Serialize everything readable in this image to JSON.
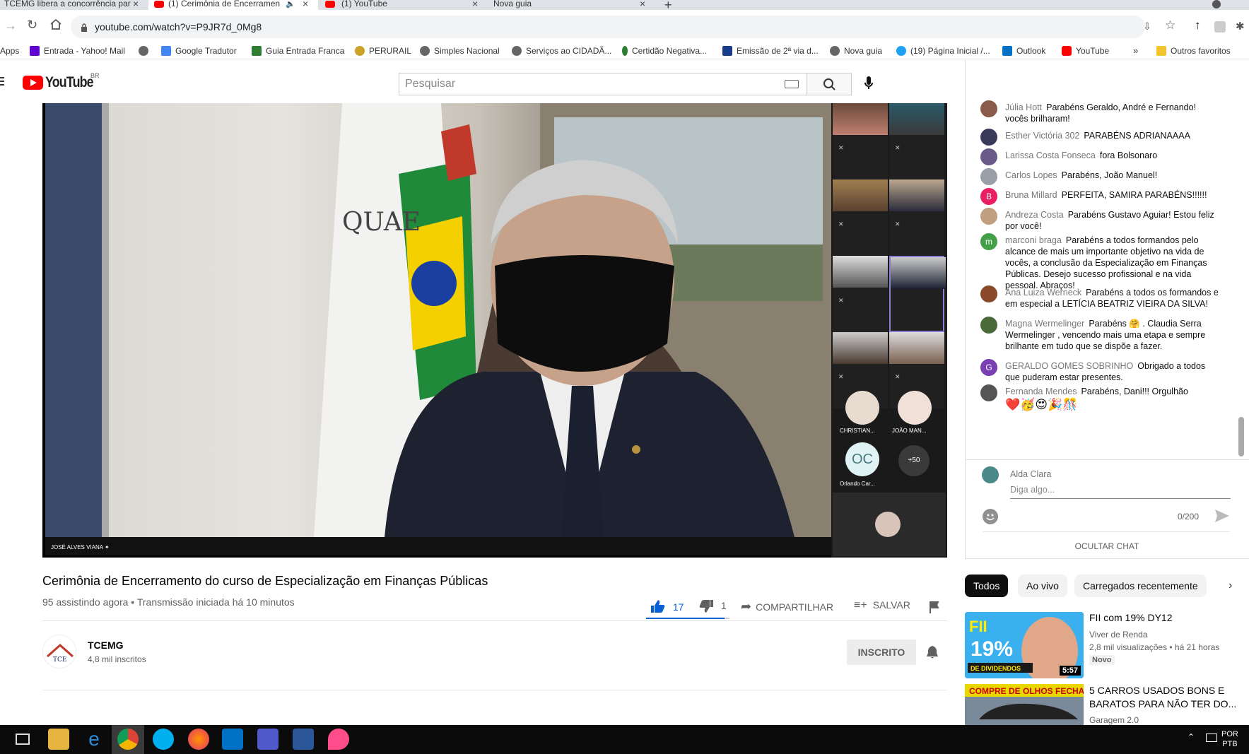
{
  "tabs": [
    {
      "title": "TCEMG libera a concorrência par",
      "active": false
    },
    {
      "title": "(1) Cerimônia de Encerramen",
      "active": true
    },
    {
      "title": "(1) YouTube",
      "active": false
    },
    {
      "title": "Nova guia",
      "active": false
    }
  ],
  "url": "youtube.com/watch?v=P9JR7d_0Mg8",
  "bookmarks": [
    "Apps",
    "Entrada - Yahoo! Mail",
    "Google Tradutor",
    "Guia Entrada Franca",
    "PERURAIL",
    "Simples Nacional",
    "Serviços ao CIDADÃ...",
    "Certidão Negativa...",
    "Emissão de 2ª via d...",
    "Nova guia",
    "(19) Página Inicial /...",
    "Outlook",
    "YouTube",
    "Outros favoritos"
  ],
  "yt": {
    "logo": "YouTube",
    "region": "BR",
    "search_placeholder": "Pesquisar"
  },
  "video": {
    "speaker_label": "JOSÉ ALVES VIANA",
    "participants": [
      "CHRISTIAN...",
      "JOÃO MAN...",
      "Orlando Car..."
    ],
    "avatar_initials": "OC",
    "more_count": "+50",
    "title": "Cerimônia de Encerramento do curso de Especialização em Finanças Públicas",
    "views": "95 assistindo agora • Transmissão iniciada há 10 minutos",
    "likes": "17",
    "dislikes": "1",
    "share": "COMPARTILHAR",
    "save": "SALVAR",
    "like_ratio": 0.94
  },
  "channel": {
    "name": "TCEMG",
    "subs": "4,8 mil inscritos",
    "subscribe": "INSCRITO"
  },
  "chat": {
    "messages": [
      {
        "author": "Júlia Hott",
        "text": "Parabéns Geraldo, André e Fernando! vocês brilharam!",
        "avatar_color": "#8a5a4a"
      },
      {
        "author": "Esther Victória 302",
        "text": "PARABÉNS ADRIANAAAA",
        "avatar_color": "#3a3a5a"
      },
      {
        "author": "Larissa Costa Fonseca",
        "text": "fora Bolsonaro",
        "avatar_color": "#6a5a8a"
      },
      {
        "author": "Carlos Lopes",
        "text": "Parabéns, João Manuel!",
        "avatar_color": "#9aa0aa"
      },
      {
        "author": "Bruna Millard",
        "text": "PERFEITA, SAMIRA PARABÉNS!!!!!!",
        "avatar_color": "#e91e63",
        "initial": "B"
      },
      {
        "author": "Andreza Costa",
        "text": "Parabéns Gustavo Aguiar! Estou feliz por você!",
        "avatar_color": "#c0a080"
      },
      {
        "author": "marconi braga",
        "text": "Parabéns a todos formandos pelo alcance de mais um importante objetivo na vida de vocês, a conclusão da Especialização em Finanças Públicas. Desejo sucesso profissional e na vida pessoal. Abraços!",
        "avatar_color": "#43a047",
        "initial": "m"
      },
      {
        "author": "Ana Luiza Werneck",
        "text": "Parabéns a todos os formandos e em especial a LETÍCIA BEATRIZ VIEIRA DA SILVA!",
        "avatar_color": "#8a4a2a"
      },
      {
        "author": "Magna Wermelinger",
        "text": "Parabéns 🤗 . Claudia Serra Wermelinger , vencendo mais uma etapa e sempre brilhante em tudo que se dispõe a fazer.",
        "avatar_color": "#4a6a3a"
      },
      {
        "author": "GERALDO GOMES SOBRINHO",
        "text": "Obrigado a todos que puderam estar presentes.",
        "avatar_color": "#7b3fb5",
        "initial": "G"
      },
      {
        "author": "Fernanda Mendes",
        "text": "Parabéns, Dani!!! Orgulhão",
        "avatar_color": "#555",
        "emojis": "❤️🥳😍🎉🎊"
      }
    ],
    "current_user": "Alda Clara",
    "input_placeholder": "Diga algo...",
    "counter": "0/200",
    "hide": "OCULTAR CHAT"
  },
  "chips": [
    "Todos",
    "Ao vivo",
    "Carregados recentemente"
  ],
  "recs": [
    {
      "title": "FII com 19% DY12",
      "channel": "Viver de Renda",
      "meta": "2,8 mil visualizações • há 21 horas",
      "badge": "Novo",
      "duration": "5:57",
      "thumb_text": "FII com 19% DE DIVIDENDOS"
    },
    {
      "title": "5 CARROS USADOS BONS E BARATOS PARA NÃO TER DO...",
      "channel": "Garagem 2.0",
      "thumb_text": "COMPRE DE OLHOS FECHADOS!"
    }
  ],
  "taskbar": {
    "lang1": "POR",
    "lang2": "PTB"
  },
  "colors": {
    "yt_red": "#ff0000",
    "like_blue": "#065fd4"
  }
}
